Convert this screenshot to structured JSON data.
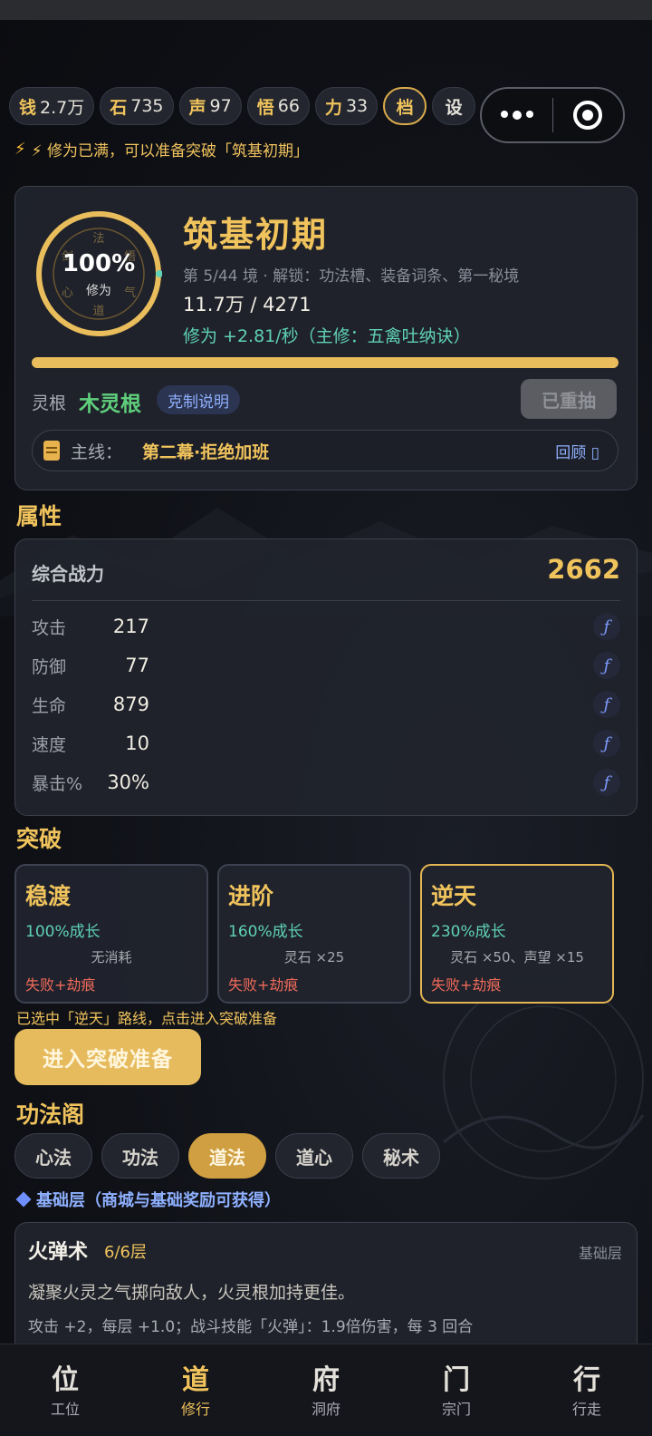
{
  "resources": [
    {
      "icon": "钱",
      "value": "2.7万"
    },
    {
      "icon": "石",
      "value": "735"
    },
    {
      "icon": "声",
      "value": "97"
    },
    {
      "icon": "悟",
      "value": "66"
    },
    {
      "icon": "力",
      "value": "33"
    }
  ],
  "archive_label": "档",
  "settings_label": "设",
  "notice": "⚡ 修为已满，可以准备突破「筑基初期」",
  "realm": {
    "progress_pct": "100%",
    "progress_fraction": 1.0,
    "progress_sub": "修为",
    "ring_glyphs": [
      "法",
      "悟",
      "气",
      "道",
      "心",
      "剑"
    ],
    "name": "筑基初期",
    "desc": "第 5/44 境 · 解锁：功法槽、装备词条、第一秘境",
    "progress_text": "11.7万 / 4271",
    "rate": "修为 +2.81/秒（主修：五禽吐纳诀）",
    "bar_fraction": 1.0,
    "root_label": "灵根",
    "root_value": "木灵根",
    "restraint_btn": "克制说明",
    "reroll_btn": "已重抽",
    "mainline_label": "主线：",
    "mainline_value": "第二幕·拒绝加班",
    "mainline_review": "回顾 ▯"
  },
  "attributes": {
    "title": "属性",
    "power_label": "综合战力",
    "power_value": "2662",
    "rows": [
      {
        "name": "攻击",
        "value": "217",
        "icon": "ƒ"
      },
      {
        "name": "防御",
        "value": "77",
        "icon": "ƒ"
      },
      {
        "name": "生命",
        "value": "879",
        "icon": "ƒ"
      },
      {
        "name": "速度",
        "value": "10",
        "icon": "ƒ"
      },
      {
        "name": "暴击%",
        "value": "30%",
        "icon": "ƒ"
      }
    ]
  },
  "breakthrough": {
    "title": "突破",
    "options": [
      {
        "name": "稳渡",
        "growth": "100%成长",
        "cost": "无消耗",
        "fail": "失败+劫痕",
        "selected": false
      },
      {
        "name": "进阶",
        "growth": "160%成长",
        "cost": "灵石 ×25",
        "fail": "失败+劫痕",
        "selected": false
      },
      {
        "name": "逆天",
        "growth": "230%成长",
        "cost": "灵石 ×50、声望 ×15",
        "fail": "失败+劫痕",
        "selected": true
      }
    ],
    "hint": "已选中「逆天」路线，点击进入突破准备",
    "enter_btn": "进入突破准备"
  },
  "techniques": {
    "title": "功法阁",
    "tabs": [
      "心法",
      "功法",
      "道法",
      "道心",
      "秘术"
    ],
    "active_tab": "道法",
    "layer_title": "基础层（商城与基础奖励可获得）",
    "skill": {
      "name": "火弹术",
      "level": "6/6层",
      "tag": "基础层",
      "desc": "凝聚火灵之气掷向敌人，火灵根加持更佳。",
      "effect": "攻击 +2，每层 +1.0；战斗技能「火弹」：1.9倍伤害，每 3 回合"
    }
  },
  "nav": [
    {
      "glyph": "位",
      "label": "工位"
    },
    {
      "glyph": "道",
      "label": "修行"
    },
    {
      "glyph": "府",
      "label": "洞府"
    },
    {
      "glyph": "门",
      "label": "宗门"
    },
    {
      "glyph": "行",
      "label": "行走"
    }
  ],
  "nav_active": "修行",
  "colors": {
    "accent": "#f0c35c",
    "teal": "#5fd1b7",
    "danger": "#ef6a5a",
    "link": "#8fb0ff",
    "wood": "#5fcf7c"
  }
}
